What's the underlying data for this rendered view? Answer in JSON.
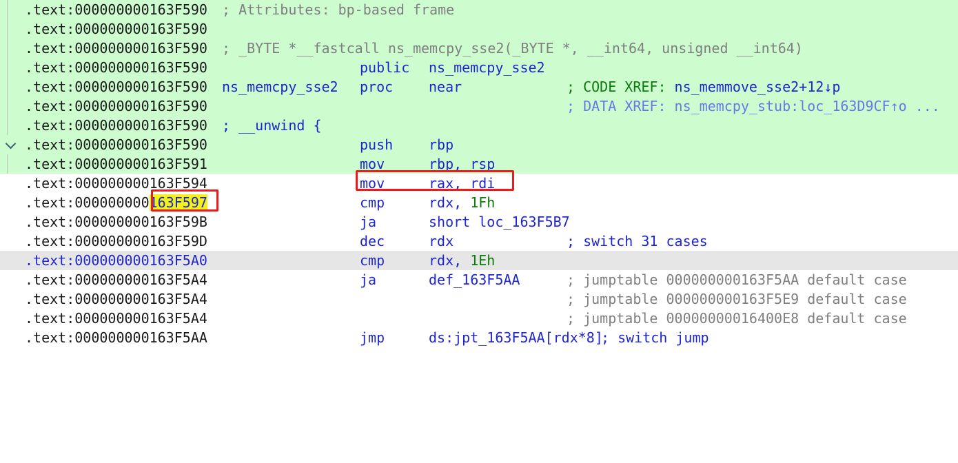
{
  "colors": {
    "highlight_green": "#cdfccf",
    "highlight_gray": "#e6e6e6",
    "keyword_blue": "#1f26cc",
    "comment_gray": "#7f7f7f",
    "xref_green": "#0c7a0c",
    "xref_data": "#6878e6",
    "search_yellow": "#f2f21a",
    "annotation_red": "#e81c1c"
  },
  "rows": [
    {
      "addr": ".text:000000000163F590",
      "label": "",
      "mnem": "",
      "ops": "",
      "comment": "; Attributes: bp-based frame",
      "comment_at_label": true
    },
    {
      "addr": ".text:000000000163F590",
      "label": "",
      "mnem": "",
      "ops": "",
      "comment": ""
    },
    {
      "addr": ".text:000000000163F590",
      "label": "",
      "mnem": "",
      "ops": "",
      "comment": "; _BYTE *__fastcall ns_memcpy_sse2(_BYTE *, __int64, unsigned __int64)",
      "comment_at_label": true
    },
    {
      "addr": ".text:000000000163F590",
      "label": "",
      "mnem": "public",
      "ops": "ns_memcpy_sse2",
      "comment": ""
    },
    {
      "addr": ".text:000000000163F590",
      "label": "ns_memcpy_sse2",
      "mnem": "proc",
      "ops": "near",
      "comment_prefix": "; CODE XREF: ",
      "comment_target": "ns_memmove_sse2+12↓p"
    },
    {
      "addr": ".text:000000000163F590",
      "label": "",
      "mnem": "",
      "ops": "",
      "comment": "; DATA XREF: ns_memcpy_stub:loc_163D9CF↑o ..."
    },
    {
      "addr": ".text:000000000163F590",
      "label": "",
      "mnem": "",
      "ops": "",
      "comment": "; __unwind {",
      "comment_at_label": true
    },
    {
      "addr": ".text:000000000163F590",
      "label": "",
      "mnem": "push",
      "ops": "rbp",
      "comment": ""
    },
    {
      "addr": ".text:000000000163F591",
      "label": "",
      "mnem": "mov",
      "ops": "rbp, rsp",
      "comment": ""
    },
    {
      "addr": ".text:000000000163F594",
      "label": "",
      "mnem": "mov",
      "ops": "rax, rdi",
      "comment": ""
    },
    {
      "addr_prefix": ".text:000000000",
      "addr_highlight": "163F597",
      "label": "",
      "mnem": "cmp",
      "ops_reg": "rdx, ",
      "ops_num": "1Fh",
      "comment": ""
    },
    {
      "addr": ".text:000000000163F59B",
      "label": "",
      "mnem": "ja",
      "ops": "short loc_163F5B7",
      "comment": ""
    },
    {
      "addr": ".text:000000000163F59D",
      "label": "",
      "mnem": "dec",
      "ops": "rdx",
      "comment": "; switch 31 cases"
    },
    {
      "addr": ".text:000000000163F5A0",
      "label": "",
      "mnem": "cmp",
      "ops_reg": "rdx, ",
      "ops_num": "1Eh",
      "comment": ""
    },
    {
      "addr": ".text:000000000163F5A4",
      "label": "",
      "mnem": "ja",
      "ops": "def_163F5AA",
      "comment": "; jumptable 000000000163F5AA default case"
    },
    {
      "addr": ".text:000000000163F5A4",
      "label": "",
      "mnem": "",
      "ops": "",
      "comment": "; jumptable 000000000163F5E9 default case"
    },
    {
      "addr": ".text:000000000163F5A4",
      "label": "",
      "mnem": "",
      "ops": "",
      "comment": "; jumptable 00000000016400E8 default case"
    },
    {
      "addr": ".text:000000000163F5AA",
      "label": "",
      "mnem": "jmp",
      "ops": "ds:jpt_163F5AA[rdx*8]",
      "comment": "; switch jump"
    }
  ]
}
